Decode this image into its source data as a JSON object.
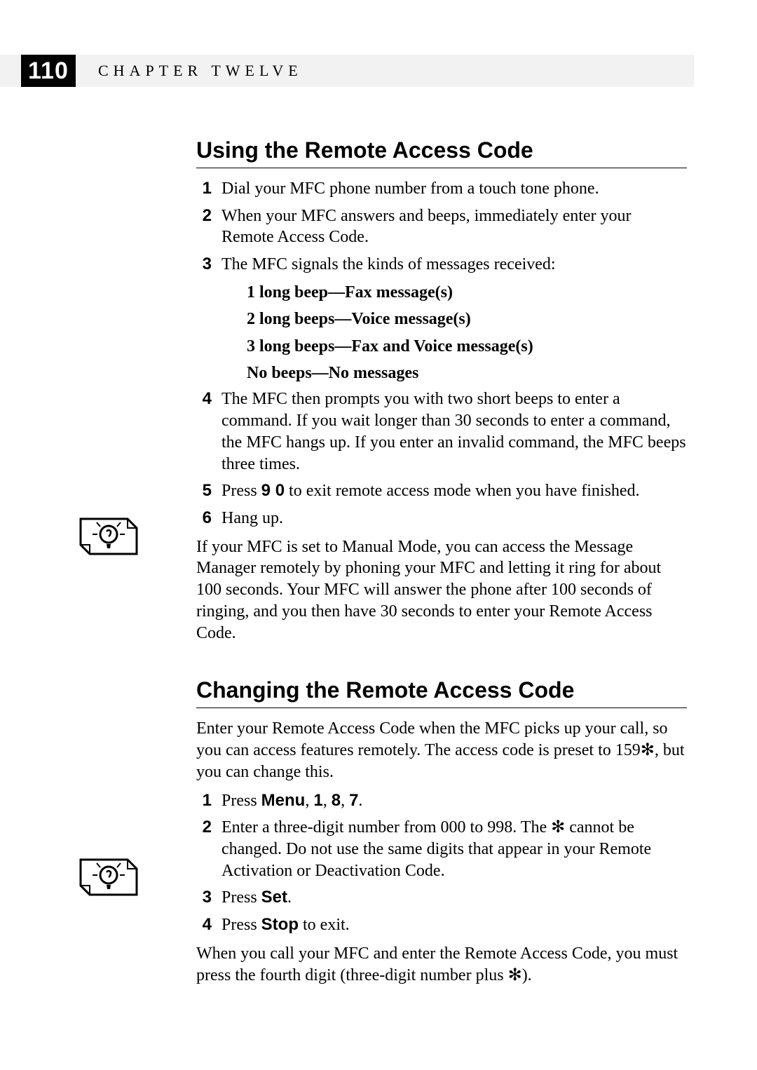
{
  "page_number": "110",
  "chapter_label": "CHAPTER TWELVE",
  "section1": {
    "title": "Using the Remote Access Code",
    "step1": "Dial your MFC phone number from a touch tone phone.",
    "step2": "When your MFC answers and beeps, immediately enter your Remote Access Code.",
    "step3": "The MFC signals the kinds of messages received:",
    "beep1": "1 long beep—Fax message(s)",
    "beep2": "2 long beeps—Voice message(s)",
    "beep3": "3 long beeps—Fax and Voice message(s)",
    "beep4": "No beeps—No messages",
    "step4": "The MFC then prompts you with two short beeps to enter a command. If you wait longer than 30 seconds to enter a command, the MFC hangs up. If you enter an invalid command, the MFC beeps three times.",
    "step5_pre": "Press ",
    "step5_keys": "9 0",
    "step5_post": " to exit remote access mode when you have finished.",
    "step6": "Hang up.",
    "note": "If your MFC is set to Manual Mode, you can access the Message Manager remotely by phoning your MFC and letting it ring for about 100 seconds. Your MFC will answer the phone after 100 seconds of ringing, and you then have 30 seconds to enter your Remote Access Code."
  },
  "section2": {
    "title": "Changing the Remote Access Code",
    "intro_a": "Enter your Remote Access Code when the MFC picks up your call, so you can access features remotely. The access code is preset to 159",
    "intro_star": "✻",
    "intro_b": ", but you can change this.",
    "step1_pre": "Press ",
    "step1_menu": "Menu",
    "step1_sep1": ", ",
    "step1_k1": "1",
    "step1_sep2": ", ",
    "step1_k2": "8",
    "step1_sep3": ", ",
    "step1_k3": "7",
    "step1_post": ".",
    "step2_a": "Enter a three-digit number from 000 to 998. The ",
    "step2_star": "✻",
    "step2_b": " cannot be changed. Do not use the same digits that appear in your Remote Activation or Deactivation Code.",
    "step3_pre": "Press ",
    "step3_key": "Set",
    "step3_post": ".",
    "step4_pre": "Press ",
    "step4_key": "Stop",
    "step4_post": " to exit.",
    "note_a": "When you call your MFC and enter the Remote Access Code, you must press the fourth digit (three-digit number plus ",
    "note_star": "✻",
    "note_b": ")."
  },
  "numbers": {
    "n1": "1",
    "n2": "2",
    "n3": "3",
    "n4": "4",
    "n5": "5",
    "n6": "6"
  }
}
